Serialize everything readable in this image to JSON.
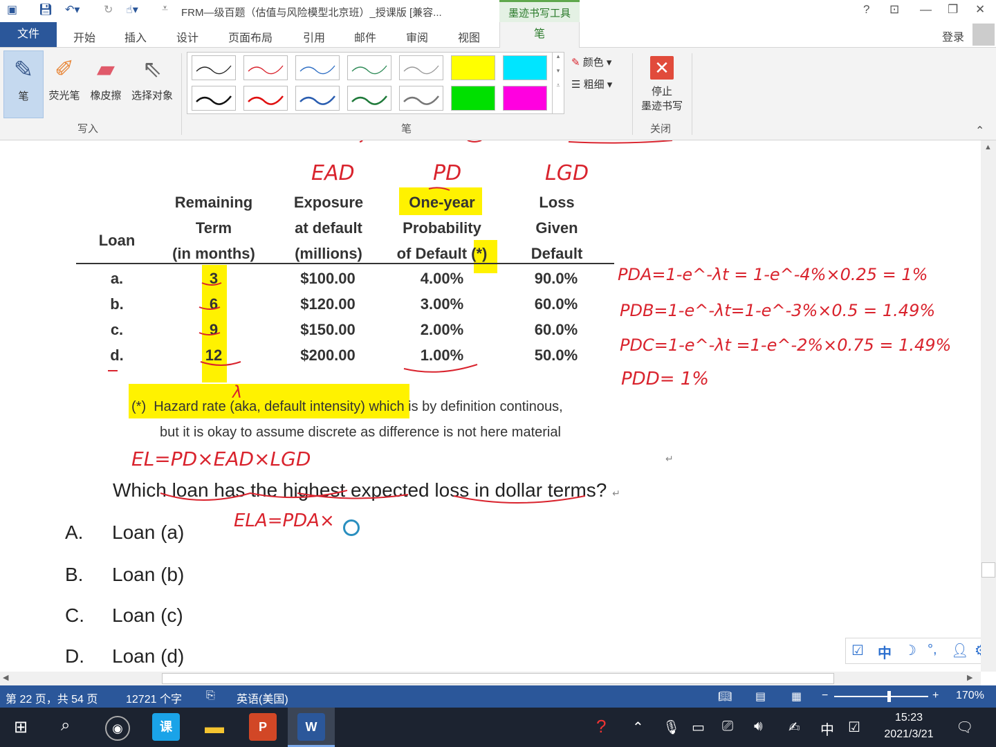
{
  "titlebar": {
    "doc_title": "FRM—级百题（估值与风险模型北京班）_授课版 [兼容...",
    "context_tab": "墨迹书写工具",
    "help": "?",
    "minimize": "—"
  },
  "tabs": {
    "file": "文件",
    "items": [
      "开始",
      "插入",
      "设计",
      "页面布局",
      "引用",
      "邮件",
      "审阅",
      "视图"
    ],
    "pen": "笔",
    "login": "登录"
  },
  "ribbon": {
    "write_buttons": [
      "笔",
      "荧光笔",
      "橡皮擦",
      "选择对象"
    ],
    "group_write": "写入",
    "group_pens": "笔",
    "color": "颜色",
    "thickness": "粗细",
    "stop": [
      "停止",
      "墨迹书写"
    ],
    "group_close": "关闭",
    "pen_colors_row1": [
      "#222222",
      "#d9232d",
      "#2f6fc4",
      "#2e8b57",
      "#999999",
      "#ffff00",
      "#00e5ff"
    ],
    "pen_colors_row2": [
      "#111111",
      "#e01010",
      "#2a5db0",
      "#1f7a3a",
      "#777777",
      "#00e000",
      "#ff00e0"
    ]
  },
  "table": {
    "headers": [
      [
        "",
        "",
        "Loan"
      ],
      [
        "Remaining",
        "Term",
        "(in months)"
      ],
      [
        "Exposure",
        "at default",
        "(millions)"
      ],
      [
        "One-year",
        "Probability",
        "of Default (*)"
      ],
      [
        "Loss",
        "Given",
        "Default"
      ]
    ],
    "rows": [
      [
        "a.",
        "3",
        "$100.00",
        "4.00%",
        "90.0%"
      ],
      [
        "b.",
        "6",
        "$120.00",
        "3.00%",
        "60.0%"
      ],
      [
        "c.",
        "9",
        "$150.00",
        "2.00%",
        "60.0%"
      ],
      [
        "d.",
        "12",
        "$200.00",
        "1.00%",
        "50.0%"
      ]
    ]
  },
  "note": {
    "line1_prefix": "(*)",
    "line1_highlight": "Hazard rate (aka, default intensity)",
    "line1_rest": " which is by definition continous,",
    "line2": "but it is okay to assume discrete as difference is not here material"
  },
  "question": "Which loan has the highest expected loss in dollar terms?",
  "options": [
    {
      "letter": "A.",
      "text": "Loan (a)"
    },
    {
      "letter": "B.",
      "text": "Loan (b)"
    },
    {
      "letter": "C.",
      "text": "Loan (c)"
    },
    {
      "letter": "D.",
      "text": "Loan (d)"
    }
  ],
  "handwriting": {
    "ead": "EAD",
    "pd": "PD",
    "lgd": "LGD",
    "lambda": "λ",
    "pda": "PDA=1-e^-λt = 1-e^-4%×0.25 = 1%",
    "pdb": "PDB=1-e^-λt=1-e^-3%×0.5 = 1.49%",
    "pdc": "PDC=1-e^-λt =1-e^-2%×0.75 = 1.49%",
    "pdd": "PDD= 1%",
    "el": "EL=PD×EAD×LGD",
    "ela": "ELA=PDA×"
  },
  "statusbar": {
    "page": "第 22 页，共 54 页",
    "words": "12721 个字",
    "language": "英语(美国)",
    "zoom": "170%"
  },
  "ime": [
    "中"
  ],
  "taskbar": {
    "apps": [
      "课",
      "P",
      "W"
    ],
    "tray_ime": "中",
    "time": "15:23",
    "date": "2021/3/21"
  }
}
